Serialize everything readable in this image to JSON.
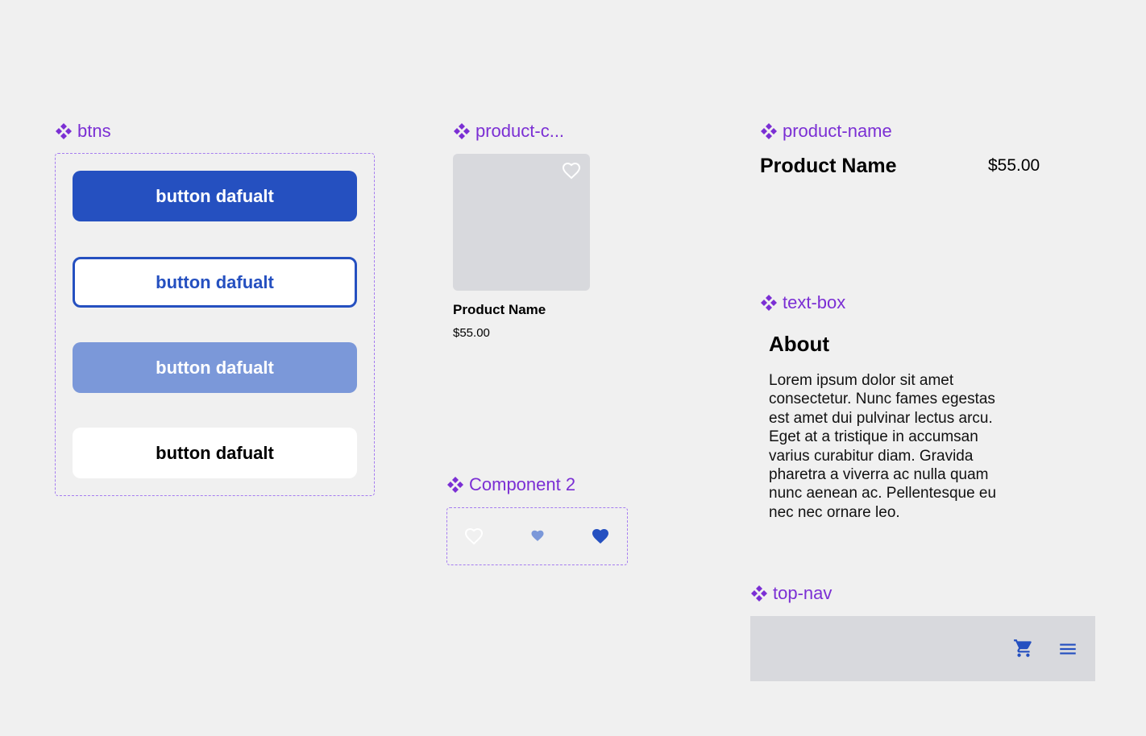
{
  "components": {
    "btns": "btns",
    "product_card": "product-c...",
    "product_name": "product-name",
    "text_box": "text-box",
    "component2": "Component 2",
    "top_nav": "top-nav"
  },
  "buttons": {
    "primary": "button dafualt",
    "outline": "button dafualt",
    "disabled": "button dafualt",
    "plain": "button dafualt"
  },
  "product_card": {
    "name": "Product Name",
    "price": "$55.00"
  },
  "product_name_row": {
    "name": "Product Name",
    "price": "$55.00"
  },
  "text_box": {
    "title": "About",
    "body": "Lorem ipsum dolor sit amet consectetur. Nunc fames egestas est amet dui pulvinar lectus arcu. Eget at a tristique in accumsan varius curabitur diam. Gravida pharetra a viverra ac nulla quam nunc aenean ac. Pellentesque eu nec nec ornare leo."
  },
  "icons": {
    "component": "component-icon",
    "heart": "heart-icon",
    "cart": "cart-icon",
    "menu": "menu-icon"
  },
  "colors": {
    "component_label": "#7b2fd4",
    "primary": "#2550c0",
    "disabled": "#7b98d9",
    "placeholder": "#d8d9dd"
  }
}
